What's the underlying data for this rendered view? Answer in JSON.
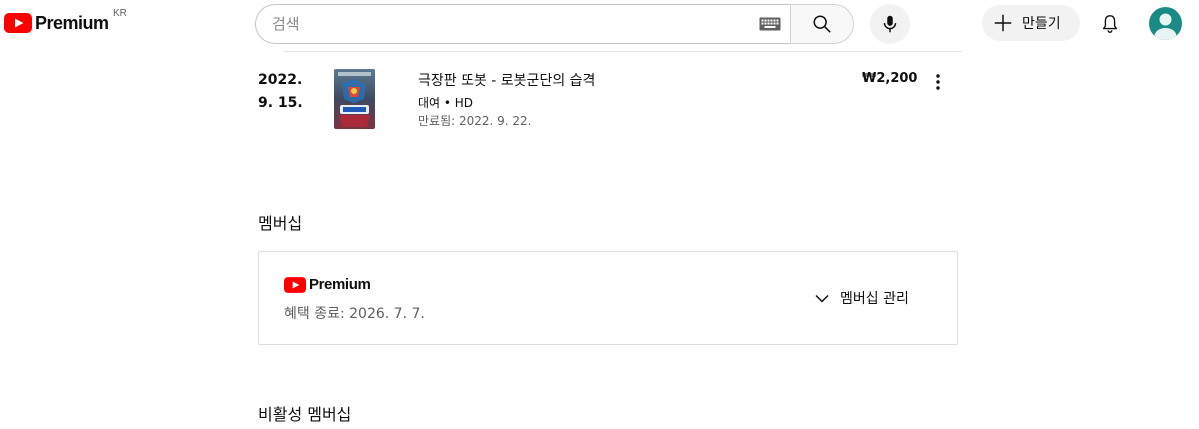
{
  "header": {
    "logo_text": "Premium",
    "country_code": "KR",
    "search_placeholder": "검색",
    "create_label": "만들기",
    "icons": [
      "youtube-play-icon",
      "keyboard-icon",
      "search-icon",
      "microphone-icon",
      "plus-icon",
      "bell-icon",
      "avatar-icon"
    ]
  },
  "purchases": [
    {
      "date": "2022. 9. 15.",
      "title": "극장판 또봇 - 로봇군단의 습격",
      "type": "대여 • HD",
      "expiry": "만료됨: 2022. 9. 22.",
      "price": "₩2,200"
    }
  ],
  "membership": {
    "section_title": "멤버십",
    "logo_text": "Premium",
    "benefit_end": "혜택 종료: 2026. 7. 7.",
    "manage_label": "멤버십 관리"
  },
  "inactive": {
    "section_title": "비활성 멤버십"
  },
  "colors": {
    "brand_red": "#ff0000",
    "text_primary": "#0f0f0f",
    "text_secondary": "#606060",
    "avatar_bg": "#1a8a84"
  }
}
